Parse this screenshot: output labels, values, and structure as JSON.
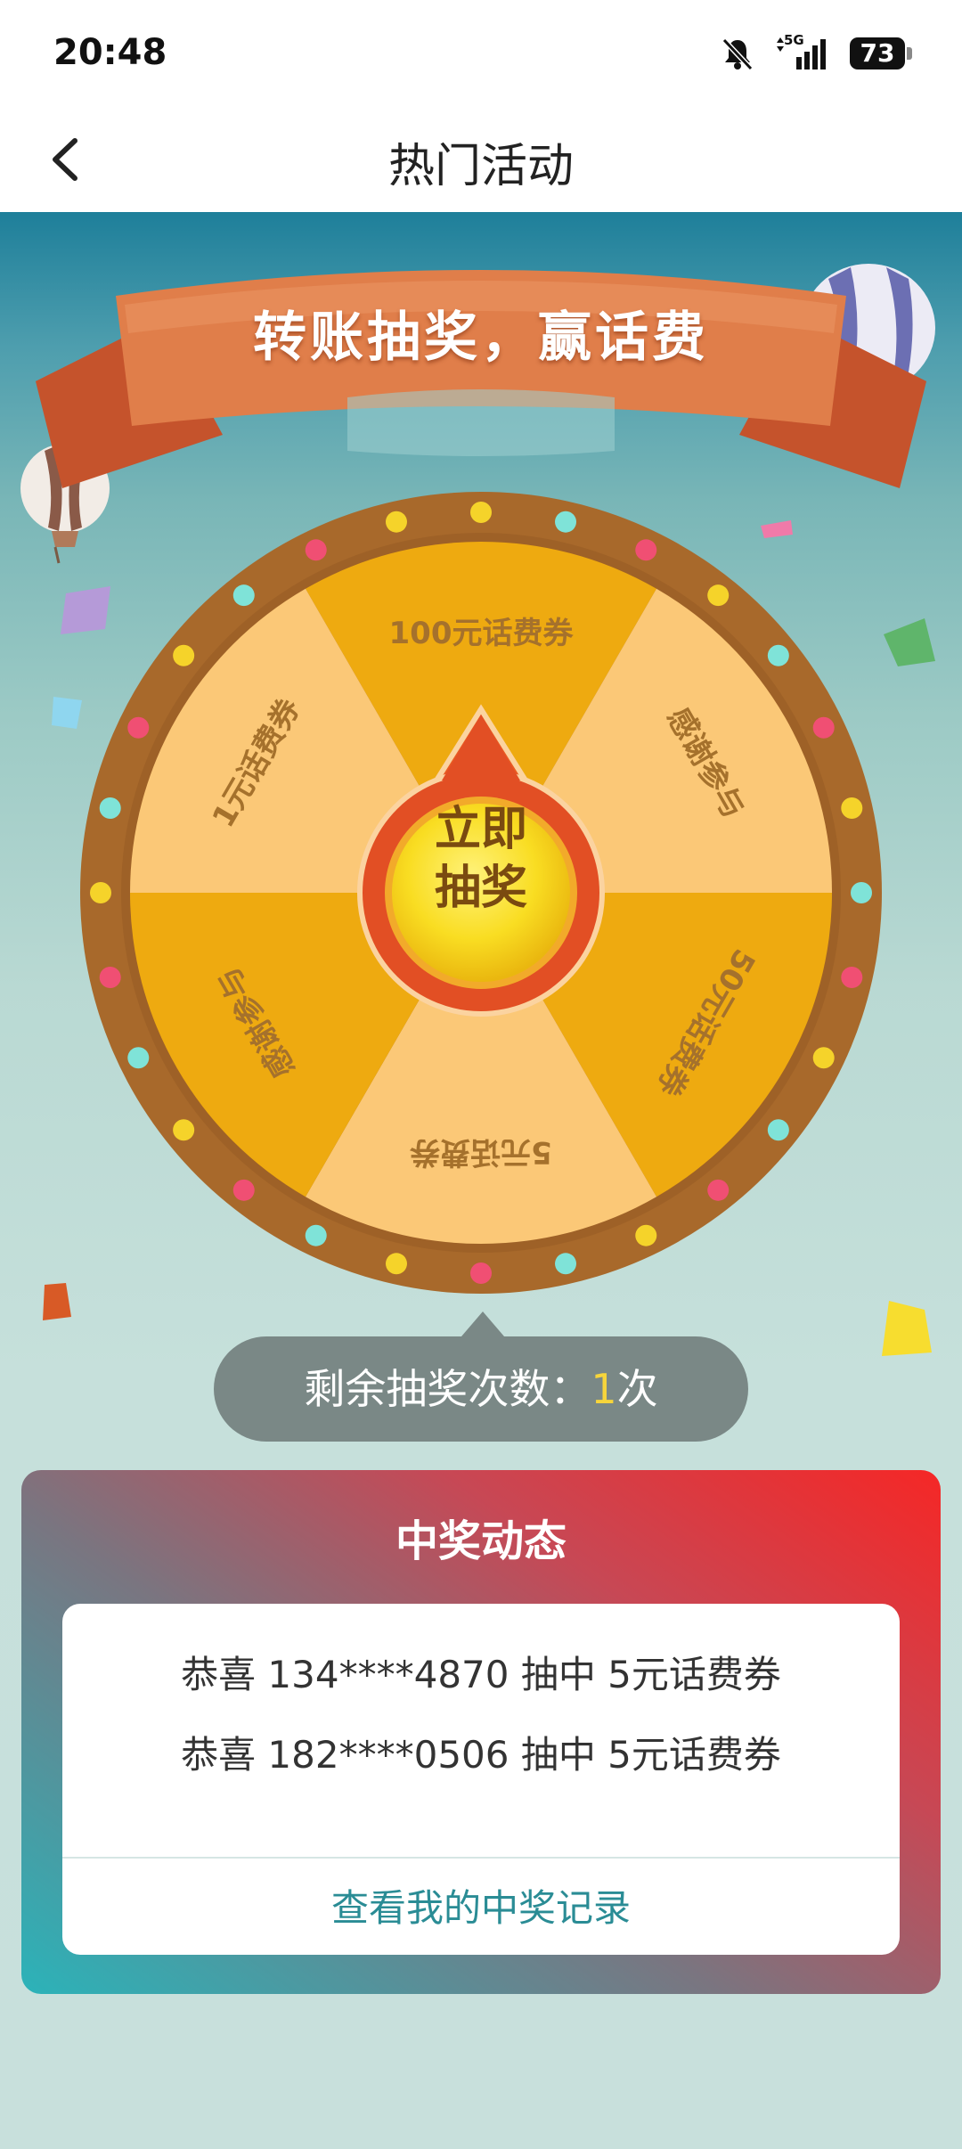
{
  "status_bar": {
    "time": "20:48",
    "network": "5G",
    "battery": "73",
    "icons": [
      "bell-muted-icon",
      "signal-icon",
      "battery-icon"
    ]
  },
  "header": {
    "title": "热门活动",
    "back_icon": "chevron-left-icon"
  },
  "banner": {
    "text": "转账抽奖，赢话费"
  },
  "wheel": {
    "segments": [
      "100元话费券",
      "感谢参与",
      "50元话费券",
      "5元话费券",
      "感谢参与",
      "1元话费券"
    ],
    "segment_colors": [
      "#eeaa10",
      "#fbc877"
    ],
    "spin_button_line1": "立即",
    "spin_button_line2": "抽奖"
  },
  "remaining": {
    "label": "剩余抽奖次数：",
    "count": "1",
    "unit": "次"
  },
  "records": {
    "title": "中奖动态",
    "winners": [
      "恭喜 134****4870 抽中 5元话费券",
      "恭喜 182****0506 抽中 5元话费券"
    ],
    "view_link": "查看我的中奖记录"
  },
  "colors": {
    "accent_orange": "#e07a45",
    "wheel_rim": "#a86a2c",
    "link_teal": "#2a8c95"
  }
}
